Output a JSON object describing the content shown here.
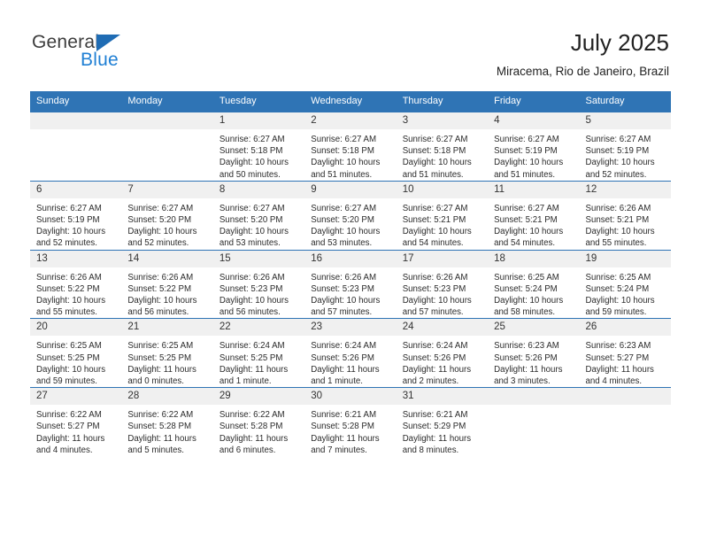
{
  "brand": {
    "name_part1": "General",
    "name_part2": "Blue",
    "flag_icon": "triangle-flag-icon",
    "colors": {
      "blue": "#1f7fd4",
      "flag": "#1f6cb4",
      "dark": "#3c3c3c"
    }
  },
  "header": {
    "title": "July 2025",
    "subtitle": "Miracema, Rio de Janeiro, Brazil"
  },
  "theme": {
    "header_bar": "#2f74b5",
    "daynum_bg": "#f0f0f0",
    "row_rule": "#2f74b5",
    "text": "#2b2b2b"
  },
  "weekdays": [
    "Sunday",
    "Monday",
    "Tuesday",
    "Wednesday",
    "Thursday",
    "Friday",
    "Saturday"
  ],
  "weeks": [
    [
      {
        "day": "",
        "empty": true
      },
      {
        "day": "",
        "empty": true
      },
      {
        "day": "1",
        "sunrise": "Sunrise: 6:27 AM",
        "sunset": "Sunset: 5:18 PM",
        "daylight": "Daylight: 10 hours and 50 minutes."
      },
      {
        "day": "2",
        "sunrise": "Sunrise: 6:27 AM",
        "sunset": "Sunset: 5:18 PM",
        "daylight": "Daylight: 10 hours and 51 minutes."
      },
      {
        "day": "3",
        "sunrise": "Sunrise: 6:27 AM",
        "sunset": "Sunset: 5:18 PM",
        "daylight": "Daylight: 10 hours and 51 minutes."
      },
      {
        "day": "4",
        "sunrise": "Sunrise: 6:27 AM",
        "sunset": "Sunset: 5:19 PM",
        "daylight": "Daylight: 10 hours and 51 minutes."
      },
      {
        "day": "5",
        "sunrise": "Sunrise: 6:27 AM",
        "sunset": "Sunset: 5:19 PM",
        "daylight": "Daylight: 10 hours and 52 minutes."
      }
    ],
    [
      {
        "day": "6",
        "sunrise": "Sunrise: 6:27 AM",
        "sunset": "Sunset: 5:19 PM",
        "daylight": "Daylight: 10 hours and 52 minutes."
      },
      {
        "day": "7",
        "sunrise": "Sunrise: 6:27 AM",
        "sunset": "Sunset: 5:20 PM",
        "daylight": "Daylight: 10 hours and 52 minutes."
      },
      {
        "day": "8",
        "sunrise": "Sunrise: 6:27 AM",
        "sunset": "Sunset: 5:20 PM",
        "daylight": "Daylight: 10 hours and 53 minutes."
      },
      {
        "day": "9",
        "sunrise": "Sunrise: 6:27 AM",
        "sunset": "Sunset: 5:20 PM",
        "daylight": "Daylight: 10 hours and 53 minutes."
      },
      {
        "day": "10",
        "sunrise": "Sunrise: 6:27 AM",
        "sunset": "Sunset: 5:21 PM",
        "daylight": "Daylight: 10 hours and 54 minutes."
      },
      {
        "day": "11",
        "sunrise": "Sunrise: 6:27 AM",
        "sunset": "Sunset: 5:21 PM",
        "daylight": "Daylight: 10 hours and 54 minutes."
      },
      {
        "day": "12",
        "sunrise": "Sunrise: 6:26 AM",
        "sunset": "Sunset: 5:21 PM",
        "daylight": "Daylight: 10 hours and 55 minutes."
      }
    ],
    [
      {
        "day": "13",
        "sunrise": "Sunrise: 6:26 AM",
        "sunset": "Sunset: 5:22 PM",
        "daylight": "Daylight: 10 hours and 55 minutes."
      },
      {
        "day": "14",
        "sunrise": "Sunrise: 6:26 AM",
        "sunset": "Sunset: 5:22 PM",
        "daylight": "Daylight: 10 hours and 56 minutes."
      },
      {
        "day": "15",
        "sunrise": "Sunrise: 6:26 AM",
        "sunset": "Sunset: 5:23 PM",
        "daylight": "Daylight: 10 hours and 56 minutes."
      },
      {
        "day": "16",
        "sunrise": "Sunrise: 6:26 AM",
        "sunset": "Sunset: 5:23 PM",
        "daylight": "Daylight: 10 hours and 57 minutes."
      },
      {
        "day": "17",
        "sunrise": "Sunrise: 6:26 AM",
        "sunset": "Sunset: 5:23 PM",
        "daylight": "Daylight: 10 hours and 57 minutes."
      },
      {
        "day": "18",
        "sunrise": "Sunrise: 6:25 AM",
        "sunset": "Sunset: 5:24 PM",
        "daylight": "Daylight: 10 hours and 58 minutes."
      },
      {
        "day": "19",
        "sunrise": "Sunrise: 6:25 AM",
        "sunset": "Sunset: 5:24 PM",
        "daylight": "Daylight: 10 hours and 59 minutes."
      }
    ],
    [
      {
        "day": "20",
        "sunrise": "Sunrise: 6:25 AM",
        "sunset": "Sunset: 5:25 PM",
        "daylight": "Daylight: 10 hours and 59 minutes."
      },
      {
        "day": "21",
        "sunrise": "Sunrise: 6:25 AM",
        "sunset": "Sunset: 5:25 PM",
        "daylight": "Daylight: 11 hours and 0 minutes."
      },
      {
        "day": "22",
        "sunrise": "Sunrise: 6:24 AM",
        "sunset": "Sunset: 5:25 PM",
        "daylight": "Daylight: 11 hours and 1 minute."
      },
      {
        "day": "23",
        "sunrise": "Sunrise: 6:24 AM",
        "sunset": "Sunset: 5:26 PM",
        "daylight": "Daylight: 11 hours and 1 minute."
      },
      {
        "day": "24",
        "sunrise": "Sunrise: 6:24 AM",
        "sunset": "Sunset: 5:26 PM",
        "daylight": "Daylight: 11 hours and 2 minutes."
      },
      {
        "day": "25",
        "sunrise": "Sunrise: 6:23 AM",
        "sunset": "Sunset: 5:26 PM",
        "daylight": "Daylight: 11 hours and 3 minutes."
      },
      {
        "day": "26",
        "sunrise": "Sunrise: 6:23 AM",
        "sunset": "Sunset: 5:27 PM",
        "daylight": "Daylight: 11 hours and 4 minutes."
      }
    ],
    [
      {
        "day": "27",
        "sunrise": "Sunrise: 6:22 AM",
        "sunset": "Sunset: 5:27 PM",
        "daylight": "Daylight: 11 hours and 4 minutes."
      },
      {
        "day": "28",
        "sunrise": "Sunrise: 6:22 AM",
        "sunset": "Sunset: 5:28 PM",
        "daylight": "Daylight: 11 hours and 5 minutes."
      },
      {
        "day": "29",
        "sunrise": "Sunrise: 6:22 AM",
        "sunset": "Sunset: 5:28 PM",
        "daylight": "Daylight: 11 hours and 6 minutes."
      },
      {
        "day": "30",
        "sunrise": "Sunrise: 6:21 AM",
        "sunset": "Sunset: 5:28 PM",
        "daylight": "Daylight: 11 hours and 7 minutes."
      },
      {
        "day": "31",
        "sunrise": "Sunrise: 6:21 AM",
        "sunset": "Sunset: 5:29 PM",
        "daylight": "Daylight: 11 hours and 8 minutes."
      },
      {
        "day": "",
        "empty": true
      },
      {
        "day": "",
        "empty": true
      }
    ]
  ]
}
